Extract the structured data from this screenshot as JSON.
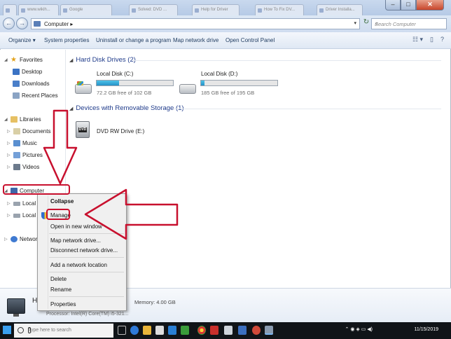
{
  "browser_tabs": [
    "",
    "www.wikih...",
    "Google",
    "Solved: DVD ...",
    "Help for Driver",
    "How To Fix DV...",
    "Driver Installa..."
  ],
  "address": {
    "crumb": "Computer",
    "search_placeholder": "Search Computer"
  },
  "toolbar": {
    "organize": "Organize",
    "system_properties": "System properties",
    "uninstall": "Uninstall or change a program",
    "map_drive": "Map network drive",
    "control_panel": "Open Control Panel"
  },
  "nav": {
    "favorites": "Favorites",
    "desktop": "Desktop",
    "downloads": "Downloads",
    "recent": "Recent Places",
    "libraries": "Libraries",
    "documents": "Documents",
    "music": "Music",
    "pictures": "Pictures",
    "videos": "Videos",
    "computer": "Computer",
    "local_c": "Local D",
    "local_d": "Local D",
    "network": "Network"
  },
  "content": {
    "hdd_group": "Hard Disk Drives (2)",
    "removable_group": "Devices with Removable Storage (1)",
    "drives": [
      {
        "name": "Local Disk (C:)",
        "free": "72.2 GB free of 102 GB",
        "used_fraction": 0.29
      },
      {
        "name": "Local Disk (D:)",
        "free": "185 GB free of 195 GB",
        "used_fraction": 0.05
      }
    ],
    "dvd": {
      "name": "DVD RW Drive (E:)",
      "label": "DVD"
    }
  },
  "context_menu": {
    "collapse": "Collapse",
    "manage": "Manage",
    "open_new": "Open in new window",
    "map_drive": "Map network drive...",
    "disconnect": "Disconnect network drive...",
    "add_location": "Add a network location",
    "delete": "Delete",
    "rename": "Rename",
    "properties": "Properties"
  },
  "details": {
    "name": "H",
    "memory": "Memory: 4.00 GB",
    "processor": "Processor: Intel(R) Core(TM) i5-321..."
  },
  "taskbar": {
    "search_placeholder": "Type here to search",
    "tray": "11/15/2019"
  },
  "colors": {
    "accent_red": "#c8102e",
    "drive_bar": "#2592c8",
    "group_title": "#1e3a8a"
  }
}
